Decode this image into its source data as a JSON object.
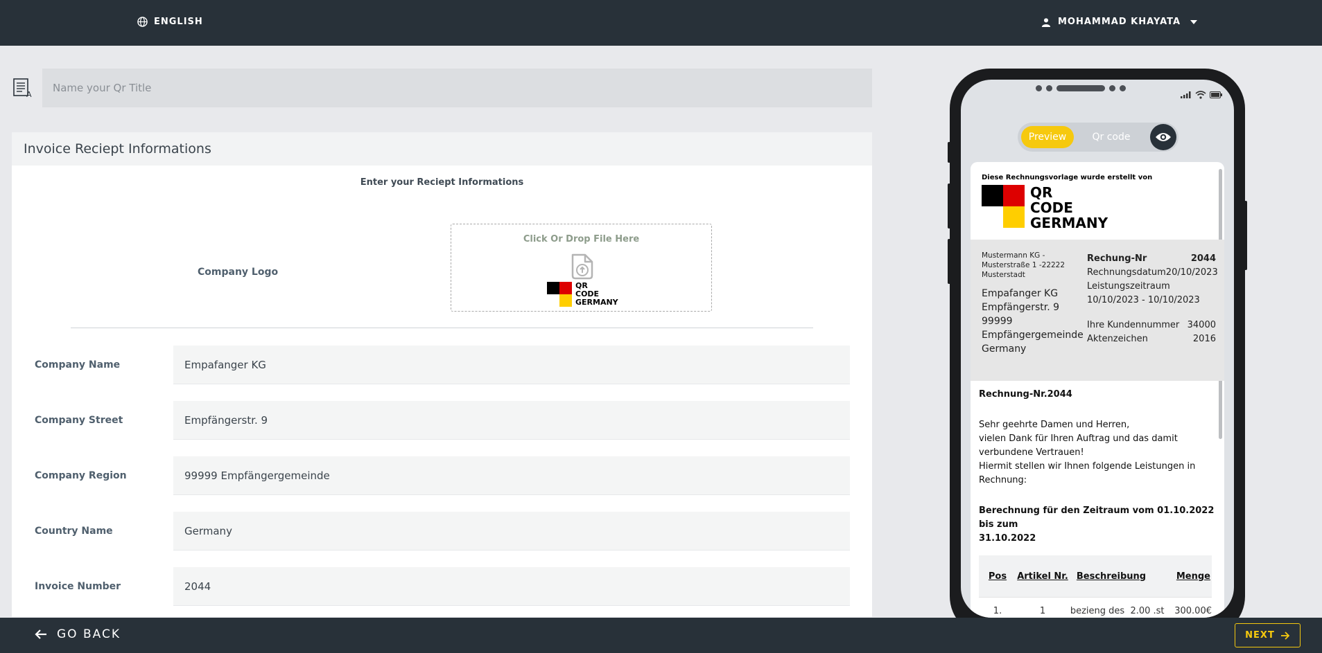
{
  "topbar": {
    "language": "ENGLISH",
    "user_name": "MOHAMMAD KHAYATA"
  },
  "title_field": {
    "placeholder": "Name your Qr Title",
    "value": ""
  },
  "card": {
    "header": "Invoice Reciept Informations",
    "subheading": "Enter your Reciept Informations",
    "logo_label": "Company Logo",
    "drop_text": "Click Or Drop File Here",
    "logo_lines": [
      "QR",
      "CODE",
      "GERMANY"
    ],
    "fields": [
      {
        "label": "Company Name",
        "value": "Empafanger KG"
      },
      {
        "label": "Company Street",
        "value": "Empfängerstr. 9"
      },
      {
        "label": "Company Region",
        "value": "99999 Empfängergemeinde"
      },
      {
        "label": "Country Name",
        "value": "Germany"
      },
      {
        "label": "Invoice Number",
        "value": "2044"
      }
    ]
  },
  "bottombar": {
    "back_label": "GO BACK",
    "next_label": "NEXT"
  },
  "phone": {
    "toggle_preview": "Preview",
    "toggle_qr": "Qr code",
    "doc": {
      "created_by": "Diese Rechnungsvorlage wurde erstellt von",
      "logo_lines": [
        "QR",
        "CODE",
        "GERMANY"
      ],
      "sender_line1": "Mustermann KG -",
      "sender_line2": "Musterstraße 1 -22222",
      "sender_line3": "Musterstadt",
      "recipient": [
        "Empafanger KG",
        "Empfängerstr. 9",
        "99999",
        "Empfängergemeinde",
        "Germany"
      ],
      "invoice_label": "Rechung-Nr",
      "invoice_number": "2044",
      "date_label": "Rechnungsdatum",
      "date_value": "20/10/2023",
      "period_label": "Leistungszeitraum",
      "period_value": "10/10/2023 - 10/10/2023",
      "customer_label": "Ihre Kundennummer",
      "customer_value": "34000",
      "file_label": "Aktenzeichen",
      "file_value": "2016",
      "heading": "Rechnung-Nr.2044",
      "greeting": "Sehr geehrte Damen und Herren,",
      "thanks_1": "vielen Dank für Ihren Auftrag und das damit",
      "thanks_2": "verbundene Vertrauen!",
      "offer_1": "Hiermit stellen wir Ihnen folgende Leistungen in",
      "offer_2": "Rechnung:",
      "period_heading_1": "Berechnung für den Zeitraum vom 01.10.2022 bis zum",
      "period_heading_2": "31.10.2022",
      "table_headers": [
        "Pos",
        "Artikel Nr.",
        "Beschreibung",
        "Menge"
      ],
      "table_row": [
        "1.",
        "1",
        "bezieng des",
        "2.00 .st",
        "300.00€"
      ]
    }
  },
  "colors": {
    "topbar": "#283139",
    "accent": "#f6c90e",
    "flag_black": "#000000",
    "flag_red": "#dd0000",
    "flag_gold": "#ffce00"
  }
}
